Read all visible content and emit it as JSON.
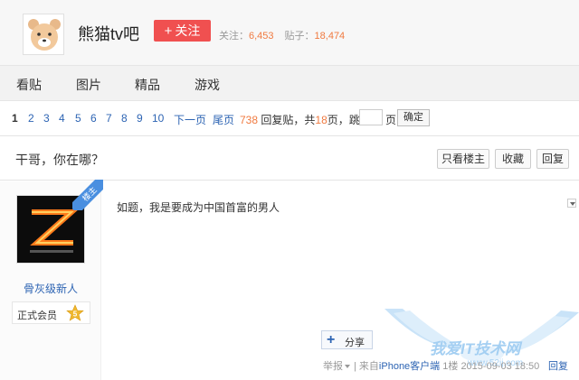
{
  "header": {
    "forum_name": "熊猫tv吧",
    "follow_label": "关注",
    "follow_plus": "+",
    "stats": {
      "followers_label": "关注：",
      "followers_value": "6,453",
      "posts_label": "贴子：",
      "posts_value": "18,474"
    }
  },
  "nav": {
    "items": [
      "看贴",
      "图片",
      "精品",
      "游戏"
    ]
  },
  "pager": {
    "pages": [
      "1",
      "2",
      "3",
      "4",
      "5",
      "6",
      "7",
      "8",
      "9",
      "10"
    ],
    "next_label": "下一页",
    "last_label": "尾页",
    "reply_count": "738",
    "reply_label": "回复贴，共",
    "page_count": "18",
    "page_count_suffix": "页，跳到",
    "page_unit": "页",
    "confirm_label": "确定"
  },
  "thread": {
    "title": "干哥，你在哪？",
    "buttons": {
      "only_op": "只看楼主",
      "favorite": "收藏",
      "reply": "回复"
    }
  },
  "post": {
    "op_badge": "楼主",
    "username": "骨灰级新人",
    "member_label": "正式会员",
    "level": "5",
    "content": "如题，我是要成为中国首富的男人",
    "share_label": "分享",
    "footer": {
      "report": "举报",
      "source_prefix": "| 来自",
      "source_link": "iPhone客户端",
      "floor": "1楼",
      "time": "2015-09-03 18:50"
    },
    "reply_label": "回复"
  },
  "watermark": {
    "text": "我爱IT技术网",
    "url": "www.52ij.com"
  },
  "colors": {
    "accent_blue": "#2d64b3",
    "follow_red": "#f05050",
    "number_orange": "#f07a40",
    "op_ribbon": "#4a8fe0"
  }
}
